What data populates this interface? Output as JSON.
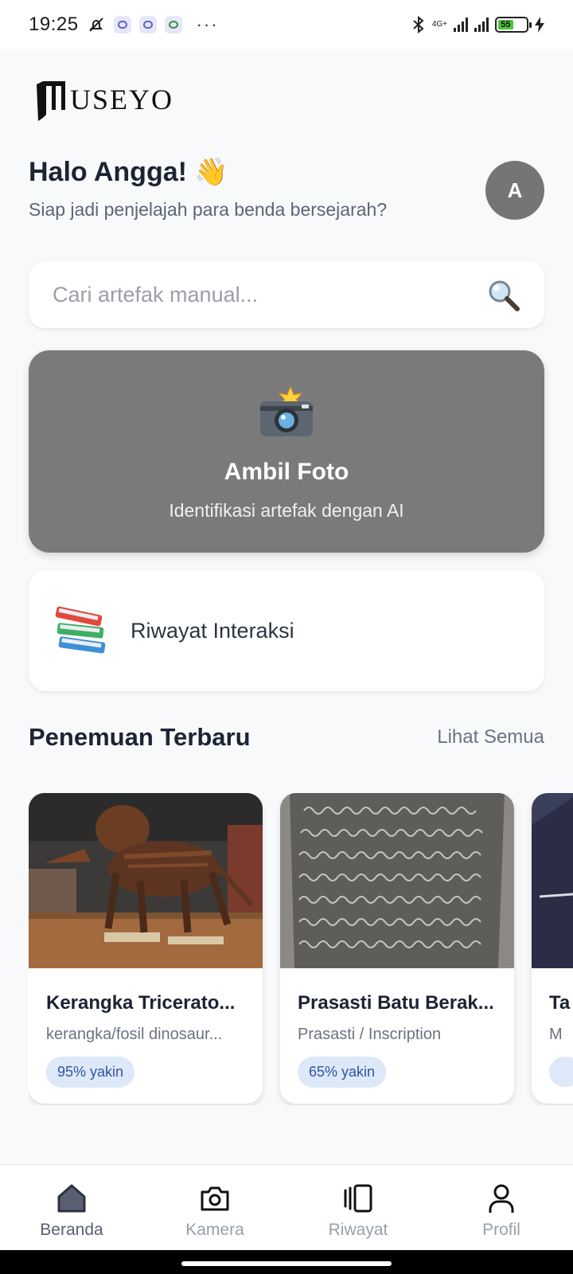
{
  "status_bar": {
    "time": "19:25",
    "network": "4G+",
    "battery": "55"
  },
  "app": {
    "logo_text": "USEYO"
  },
  "header": {
    "greeting": "Halo Angga! 👋",
    "subtitle": "Siap jadi penjelajah para benda bersejarah?",
    "avatar_initial": "A"
  },
  "search": {
    "placeholder": "Cari artefak manual...",
    "value": "",
    "icon": "search-icon"
  },
  "camera_card": {
    "icon": "camera-flash-icon",
    "title": "Ambil Foto",
    "subtitle": "Identifikasi artefak dengan AI"
  },
  "history_card": {
    "icon": "books-icon",
    "label": "Riwayat Interaksi"
  },
  "discoveries": {
    "title": "Penemuan Terbaru",
    "see_all": "Lihat Semua",
    "items": [
      {
        "title": "Kerangka Tricerato...",
        "category": "kerangka/fosil dinosaur...",
        "confidence": "95% yakin"
      },
      {
        "title": "Prasasti Batu Berak...",
        "category": "Prasasti / Inscription",
        "confidence": "65% yakin"
      },
      {
        "title": "Ta",
        "category": "M",
        "confidence": ""
      }
    ]
  },
  "bottom_nav": {
    "items": [
      {
        "label": "Beranda",
        "icon": "home-icon",
        "active": true
      },
      {
        "label": "Kamera",
        "icon": "camera-icon",
        "active": false
      },
      {
        "label": "Riwayat",
        "icon": "history-cards-icon",
        "active": false
      },
      {
        "label": "Profil",
        "icon": "profile-icon",
        "active": false
      }
    ]
  },
  "colors": {
    "background": "#f8f9fb",
    "camera_card": "#7a7a7a",
    "badge_bg": "#dde8f9",
    "badge_text": "#2f55a4",
    "avatar": "#757575"
  }
}
